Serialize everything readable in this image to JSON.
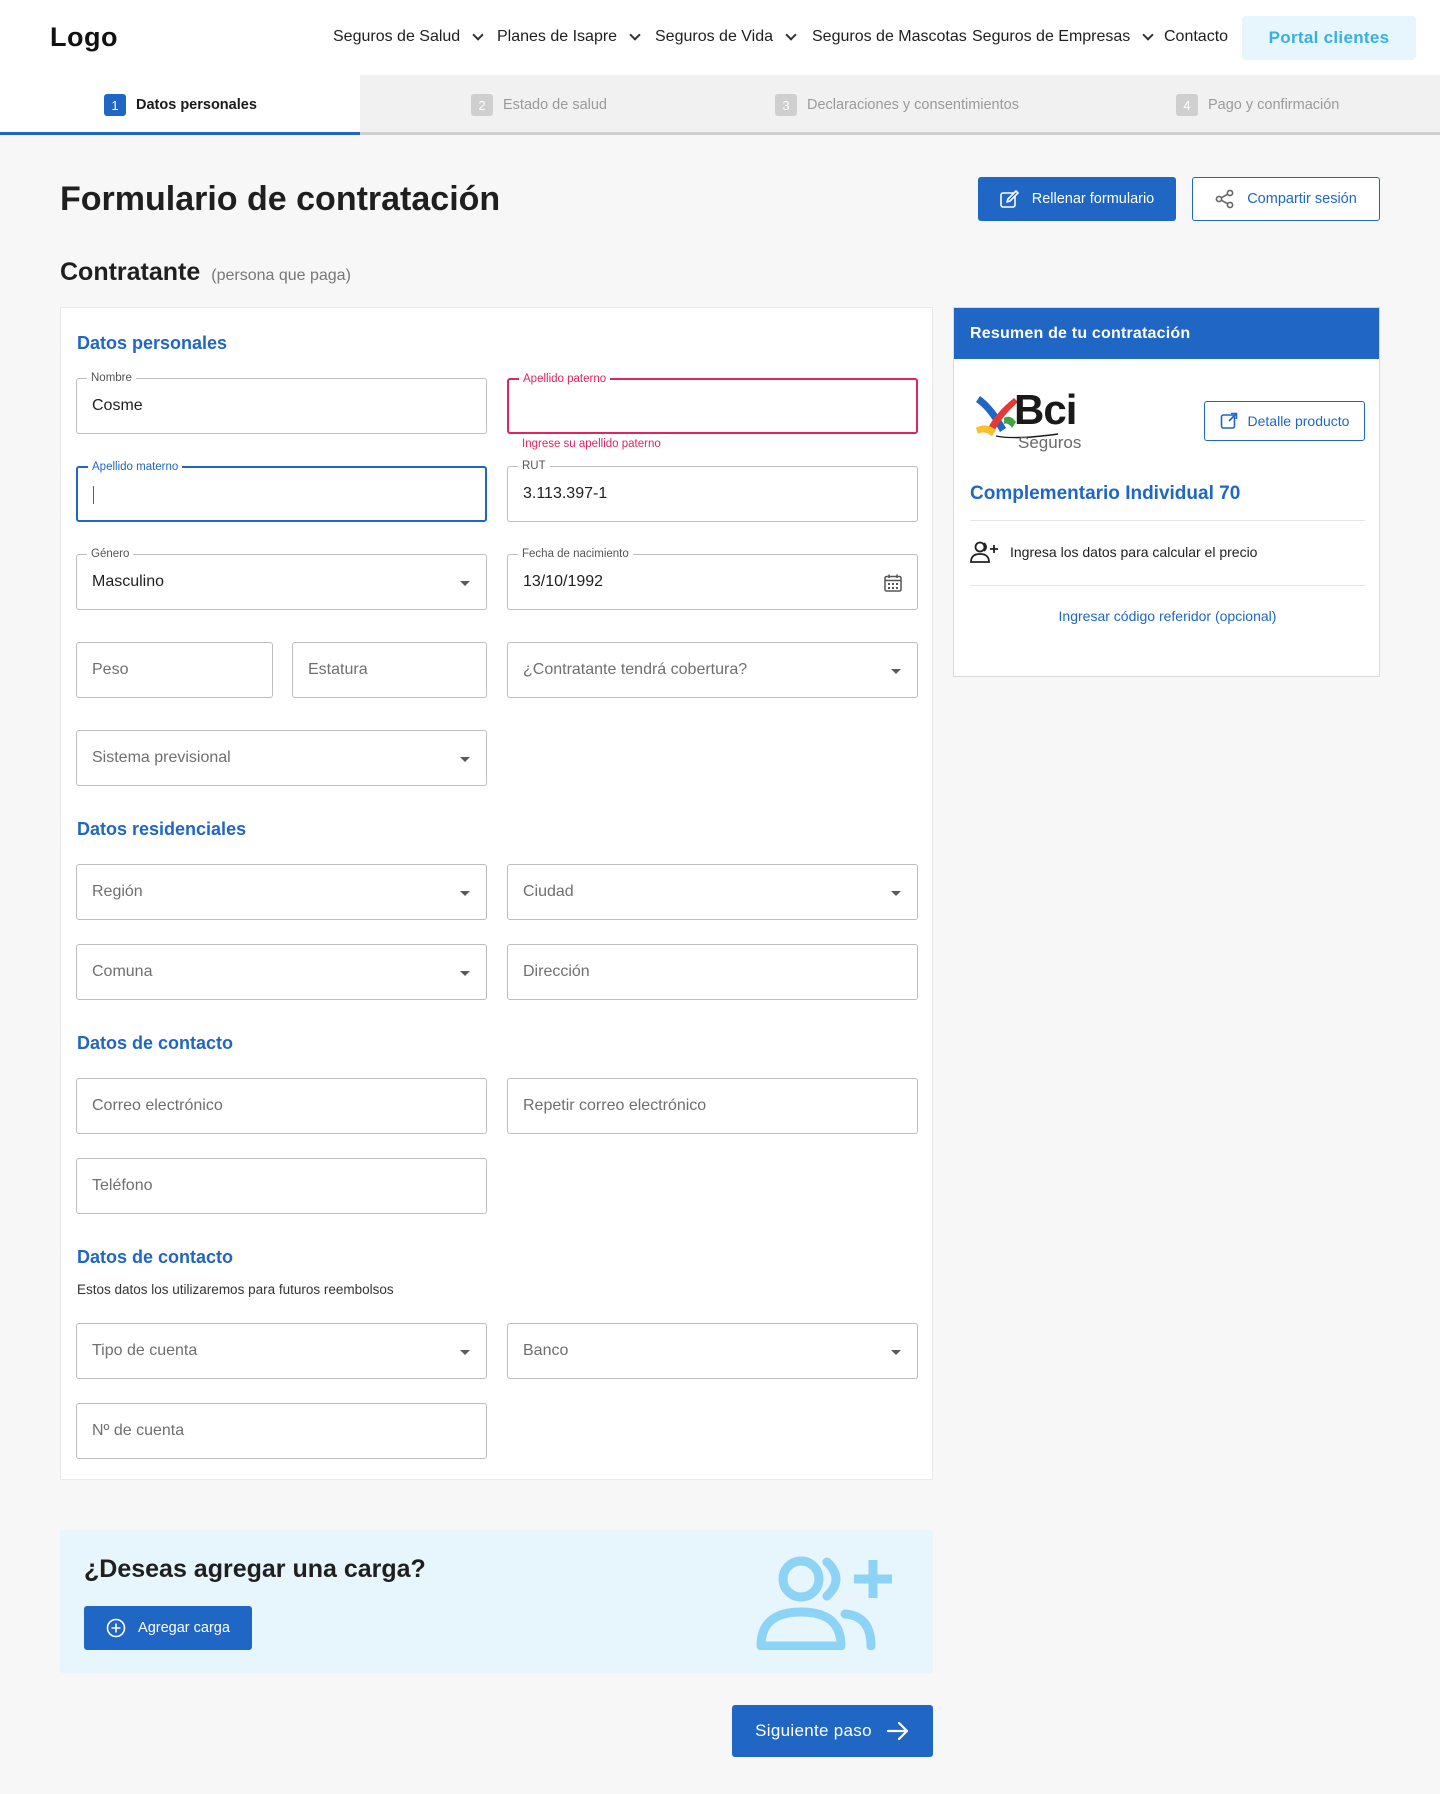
{
  "header": {
    "logo": "Logo",
    "nav": [
      {
        "label": "Seguros de Salud",
        "has_dropdown": true
      },
      {
        "label": "Planes de Isapre",
        "has_dropdown": true
      },
      {
        "label": "Seguros de Vida",
        "has_dropdown": true
      },
      {
        "label": "Seguros de Mascotas",
        "has_dropdown": false
      },
      {
        "label": "Seguros de Empresas",
        "has_dropdown": true
      },
      {
        "label": "Contacto",
        "has_dropdown": false
      }
    ],
    "portal_button": "Portal clientes"
  },
  "stepper": {
    "steps": [
      {
        "num": "1",
        "label": "Datos personales",
        "active": true
      },
      {
        "num": "2",
        "label": "Estado de salud",
        "active": false
      },
      {
        "num": "3",
        "label": "Declaraciones y consentimientos",
        "active": false
      },
      {
        "num": "4",
        "label": "Pago y confirmación",
        "active": false
      }
    ]
  },
  "page": {
    "title": "Formulario de contratación",
    "fill_button": "Rellenar formulario",
    "share_button": "Compartir sesión",
    "subtitle": "Contratante",
    "subtitle_note": "(persona que paga)"
  },
  "form": {
    "personal": {
      "title": "Datos personales",
      "nombre": {
        "label": "Nombre",
        "value": "Cosme"
      },
      "apellido_paterno": {
        "label": "Apellido paterno",
        "value": "",
        "error": "Ingrese su apellido paterno"
      },
      "apellido_materno": {
        "label": "Apellido materno",
        "value": ""
      },
      "rut": {
        "label": "RUT",
        "value": "3.113.397-1"
      },
      "genero": {
        "label": "Género",
        "value": "Masculino"
      },
      "fecha_nacimiento": {
        "label": "Fecha de nacimiento",
        "value": "13/10/1992"
      },
      "peso": {
        "placeholder": "Peso"
      },
      "estatura": {
        "placeholder": "Estatura"
      },
      "cobertura": {
        "placeholder": "¿Contratante tendrá cobertura?"
      },
      "sistema_previsional": {
        "placeholder": "Sistema previsional"
      }
    },
    "residencial": {
      "title": "Datos residenciales",
      "region": {
        "placeholder": "Región"
      },
      "ciudad": {
        "placeholder": "Ciudad"
      },
      "comuna": {
        "placeholder": "Comuna"
      },
      "direccion": {
        "placeholder": "Dirección"
      }
    },
    "contacto": {
      "title": "Datos de contacto",
      "correo": {
        "placeholder": "Correo electrónico"
      },
      "repetir_correo": {
        "placeholder": "Repetir correo electrónico"
      },
      "telefono": {
        "placeholder": "Teléfono"
      }
    },
    "bancario": {
      "title": "Datos de contacto",
      "note": "Estos datos los utilizaremos para futuros reembolsos",
      "tipo_cuenta": {
        "placeholder": "Tipo de cuenta"
      },
      "banco": {
        "placeholder": "Banco"
      },
      "numero_cuenta": {
        "placeholder": "Nº de cuenta"
      }
    }
  },
  "summary": {
    "title": "Resumen de tu contratación",
    "brand": "Bci",
    "brand_sub": "Seguros",
    "detail_button": "Detalle producto",
    "plan_name": "Complementario Individual 70",
    "price_note": "Ingresa los datos para calcular el precio",
    "referral_link": "Ingresar código referidor (opcional)"
  },
  "carga": {
    "title": "¿Deseas agregar una carga?",
    "button": "Agregar carga"
  },
  "next_button": "Siguiente paso",
  "colors": {
    "primary": "#1f66c5",
    "error": "#e0245e",
    "portal_text": "#37b0e3",
    "light_blue_bg": "#e7f5fc",
    "carga_icon": "#8dd3f5"
  }
}
